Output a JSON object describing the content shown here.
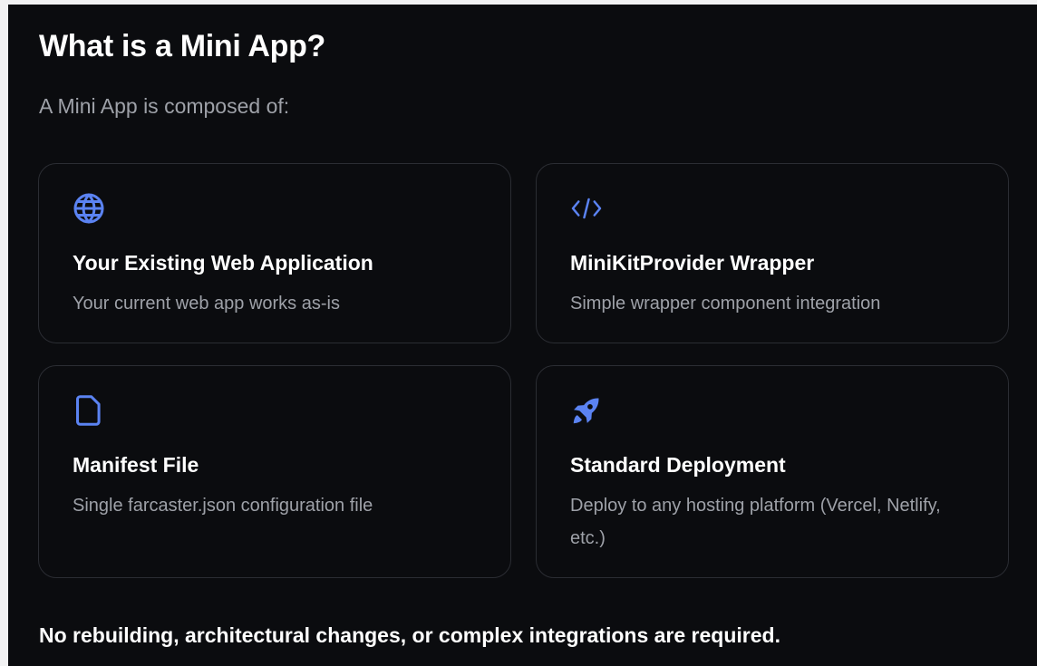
{
  "header": {
    "title": "What is a Mini App?",
    "intro": "A Mini App is composed of:"
  },
  "cards": [
    {
      "icon": "globe-icon",
      "title": "Your Existing Web Application",
      "description": "Your current web app works as-is"
    },
    {
      "icon": "code-icon",
      "title": "MiniKitProvider Wrapper",
      "description": "Simple wrapper component integration"
    },
    {
      "icon": "file-icon",
      "title": "Manifest File",
      "description": "Single farcaster.json configuration file"
    },
    {
      "icon": "rocket-icon",
      "title": "Standard Deployment",
      "description": "Deploy to any hosting platform (Vercel, Netlify, etc.)"
    }
  ],
  "footer": {
    "note": "No rebuilding, architectural changes, or complex integrations are required."
  },
  "colors": {
    "background": "#0b0c0f",
    "card_border": "#2b2d33",
    "muted_text": "#9ea1a8",
    "accent_icon": "#5b83f2"
  }
}
